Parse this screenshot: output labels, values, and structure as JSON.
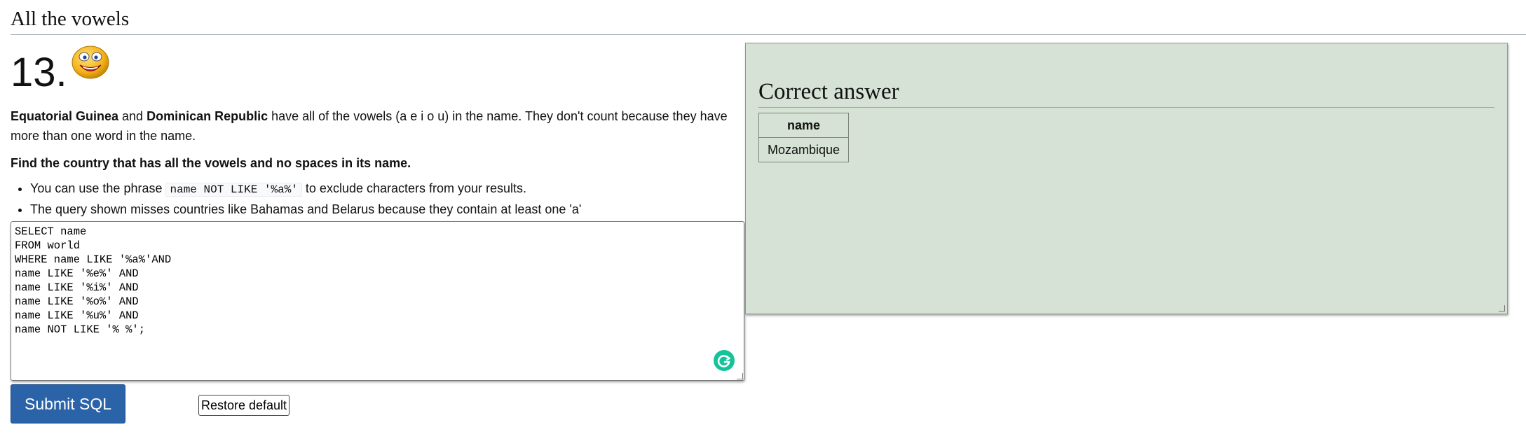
{
  "section_title": "All the vowels",
  "question": {
    "number": "13.",
    "intro": {
      "country1": "Equatorial Guinea",
      "and": " and ",
      "country2": "Dominican Republic",
      "rest": " have all of the vowels (a e i o u) in the name. They don't count because they have more than one word in the name."
    },
    "instruction": "Find the country that has all the vowels and no spaces in its name.",
    "hints": [
      {
        "before": "You can use the phrase ",
        "code": "name NOT LIKE '%a%'",
        "after": " to exclude characters from your results."
      },
      {
        "text": "The query shown misses countries like Bahamas and Belarus because they contain at least one 'a'"
      }
    ]
  },
  "editor": {
    "sql": "SELECT name\nFROM world\nWHERE name LIKE '%a%'AND\nname LIKE '%e%' AND\nname LIKE '%i%' AND\nname LIKE '%o%' AND\nname LIKE '%u%' AND\nname NOT LIKE '% %';"
  },
  "buttons": {
    "submit": "Submit SQL",
    "restore": "Restore default"
  },
  "answer": {
    "title": "Correct answer",
    "columns": [
      "name"
    ],
    "rows": [
      [
        "Mozambique"
      ]
    ]
  },
  "colors": {
    "answer_panel_bg": "#d6e2d6",
    "submit_bg": "#2a63a8",
    "grammarly": "#15c39a"
  },
  "icons": {
    "smiley": "smiley-face-icon",
    "grammarly": "grammarly-icon"
  }
}
